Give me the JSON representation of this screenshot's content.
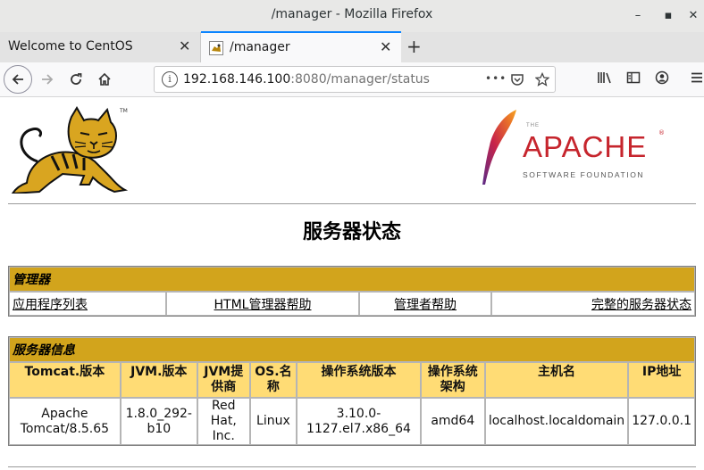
{
  "window": {
    "title": "/manager - Mozilla Firefox",
    "minimize_glyph": "–",
    "maximize_glyph": "▪",
    "close_glyph": "✕"
  },
  "tabs": [
    {
      "label": "Welcome to CentOS",
      "active": false
    },
    {
      "label": "/manager",
      "active": true
    }
  ],
  "tab_close_glyph": "✕",
  "new_tab_glyph": "+",
  "nav": {
    "url_host": "192.168.146.100",
    "url_rest": ":8080/manager/status",
    "info_glyph": "i",
    "more_glyph": "•••"
  },
  "logos": {
    "tomcat_tm": "TM",
    "apache_the": "THE",
    "apache_word": "APACHE",
    "apache_tm": "®",
    "apache_sub": "SOFTWARE FOUNDATION"
  },
  "page": {
    "heading": "服务器状态",
    "manager_section": {
      "title": "管理器",
      "links": [
        "应用程序列表",
        "HTML管理器帮助",
        "管理者帮助",
        "完整的服务器状态"
      ]
    },
    "server_info_section": {
      "title": "服务器信息",
      "headers": [
        "Tomcat.版本",
        "JVM.版本",
        "JVM提供商",
        "OS.名称",
        "操作系统版本",
        "操作系统架构",
        "主机名",
        "IP地址"
      ],
      "values": [
        "Apache Tomcat/8.5.65",
        "1.8.0_292-b10",
        "Red Hat, Inc.",
        "Linux",
        "3.10.0-1127.el7.x86_64",
        "amd64",
        "localhost.localdomain",
        "127.0.0.1"
      ]
    }
  },
  "colors": {
    "section_header_bg": "#d2a41c",
    "table_header_bg": "#ffdc75",
    "apache_red": "#c6252d",
    "tab_accent": "#0a84ff"
  }
}
